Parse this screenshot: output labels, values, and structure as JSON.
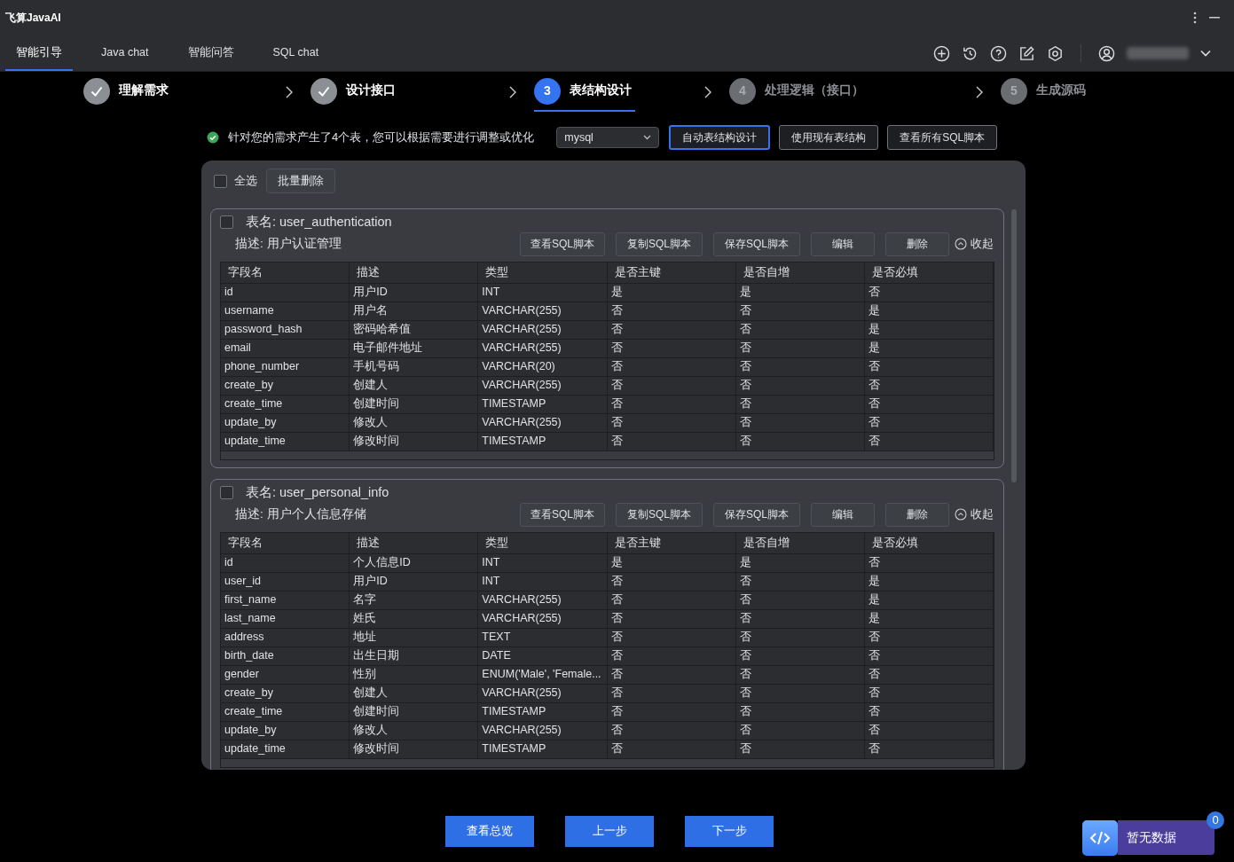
{
  "window": {
    "title": "飞算JavaAI"
  },
  "tabs": [
    {
      "label": "智能引导",
      "selected": true
    },
    {
      "label": "Java chat",
      "selected": false
    },
    {
      "label": "智能问答",
      "selected": false
    },
    {
      "label": "SQL chat",
      "selected": false
    }
  ],
  "steps": [
    {
      "label": "理解需求",
      "done": true,
      "selected": false
    },
    {
      "label": "设计接口",
      "done": true,
      "selected": false
    },
    {
      "number": "3",
      "label": "表结构设计",
      "done": false,
      "selected": true
    },
    {
      "number": "4",
      "label": "处理逻辑（接口）",
      "done": false,
      "selected": false
    },
    {
      "number": "5",
      "label": "生成源码",
      "done": false,
      "selected": false
    }
  ],
  "notice": "针对您的需求产生了4个表，您可以根据需要进行调整或优化",
  "db_select": {
    "value": "mysql"
  },
  "top_buttons": [
    {
      "label": "自动表结构设计",
      "selected": true
    },
    {
      "label": "使用现有表结构",
      "selected": false
    },
    {
      "label": "查看所有SQL脚本",
      "selected": false
    }
  ],
  "select_all": {
    "label": "全选",
    "checked": false
  },
  "batch_delete": "批量删除",
  "tables": [
    {
      "columns": [
        "字段名",
        "描述",
        "类型",
        "是否主键",
        "是否自增",
        "是否必填"
      ],
      "name": "表名: user_authentication",
      "description": "描述: 用户认证管理",
      "checked": false,
      "actions": [
        "查看SQL脚本",
        "复制SQL脚本",
        "保存SQL脚本",
        "编辑",
        "删除"
      ],
      "collapse": "收起",
      "rows": [
        [
          "id",
          "用户ID",
          "INT",
          "是",
          "是",
          "否"
        ],
        [
          "username",
          "用户名",
          "VARCHAR(255)",
          "否",
          "否",
          "是"
        ],
        [
          "password_hash",
          "密码哈希值",
          "VARCHAR(255)",
          "否",
          "否",
          "是"
        ],
        [
          "email",
          "电子邮件地址",
          "VARCHAR(255)",
          "否",
          "否",
          "是"
        ],
        [
          "phone_number",
          "手机号码",
          "VARCHAR(20)",
          "否",
          "否",
          "否"
        ],
        [
          "create_by",
          "创建人",
          "VARCHAR(255)",
          "否",
          "否",
          "否"
        ],
        [
          "create_time",
          "创建时间",
          "TIMESTAMP",
          "否",
          "否",
          "否"
        ],
        [
          "update_by",
          "修改人",
          "VARCHAR(255)",
          "否",
          "否",
          "否"
        ],
        [
          "update_time",
          "修改时间",
          "TIMESTAMP",
          "否",
          "否",
          "否"
        ]
      ]
    },
    {
      "columns": [
        "字段名",
        "描述",
        "类型",
        "是否主键",
        "是否自增",
        "是否必填"
      ],
      "name": "表名: user_personal_info",
      "description": "描述: 用户个人信息存储",
      "checked": false,
      "actions": [
        "查看SQL脚本",
        "复制SQL脚本",
        "保存SQL脚本",
        "编辑",
        "删除"
      ],
      "collapse": "收起",
      "rows": [
        [
          "id",
          "个人信息ID",
          "INT",
          "是",
          "是",
          "否"
        ],
        [
          "user_id",
          "用户ID",
          "INT",
          "否",
          "否",
          "是"
        ],
        [
          "first_name",
          "名字",
          "VARCHAR(255)",
          "否",
          "否",
          "是"
        ],
        [
          "last_name",
          "姓氏",
          "VARCHAR(255)",
          "否",
          "否",
          "是"
        ],
        [
          "address",
          "地址",
          "TEXT",
          "否",
          "否",
          "否"
        ],
        [
          "birth_date",
          "出生日期",
          "DATE",
          "否",
          "否",
          "否"
        ],
        [
          "gender",
          "性别",
          "ENUM('Male', 'Female...",
          "否",
          "否",
          "否"
        ],
        [
          "create_by",
          "创建人",
          "VARCHAR(255)",
          "否",
          "否",
          "否"
        ],
        [
          "create_time",
          "创建时间",
          "TIMESTAMP",
          "否",
          "否",
          "否"
        ],
        [
          "update_by",
          "修改人",
          "VARCHAR(255)",
          "否",
          "否",
          "否"
        ],
        [
          "update_time",
          "修改时间",
          "TIMESTAMP",
          "否",
          "否",
          "否"
        ]
      ]
    }
  ],
  "bottom_buttons": [
    "查看总览",
    "上一步",
    "下一步"
  ],
  "widget": {
    "label": "暂无数据",
    "badge": "0"
  }
}
